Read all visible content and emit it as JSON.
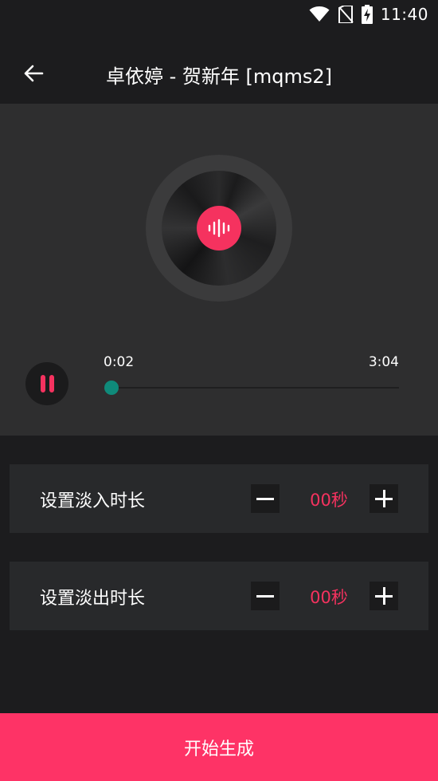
{
  "status_bar": {
    "time": "11:40",
    "icons": [
      "wifi-icon",
      "no-sim-icon",
      "battery-charging-icon"
    ]
  },
  "header": {
    "back_icon": "arrow-left-icon",
    "title": "卓依婷 - 贺新年 [mqms2]"
  },
  "player": {
    "disc_icon": "sound-wave-icon",
    "current_time": "0:02",
    "total_time": "3:04",
    "progress": 0.01,
    "pause_icon": "pause-icon"
  },
  "settings": {
    "fade_in": {
      "label": "设置淡入时长",
      "value": "00秒",
      "minus_icon": "minus-icon",
      "plus_icon": "plus-icon"
    },
    "fade_out": {
      "label": "设置淡出时长",
      "value": "00秒",
      "minus_icon": "minus-icon",
      "plus_icon": "plus-icon"
    }
  },
  "footer": {
    "generate_label": "开始生成"
  },
  "colors": {
    "accent": "#fe3366",
    "value_text": "#f5325f",
    "seek_thumb": "#0f8a7a",
    "background": "#1c1c1e",
    "player_bg": "#2e2e2f",
    "card_bg": "#28292b"
  }
}
